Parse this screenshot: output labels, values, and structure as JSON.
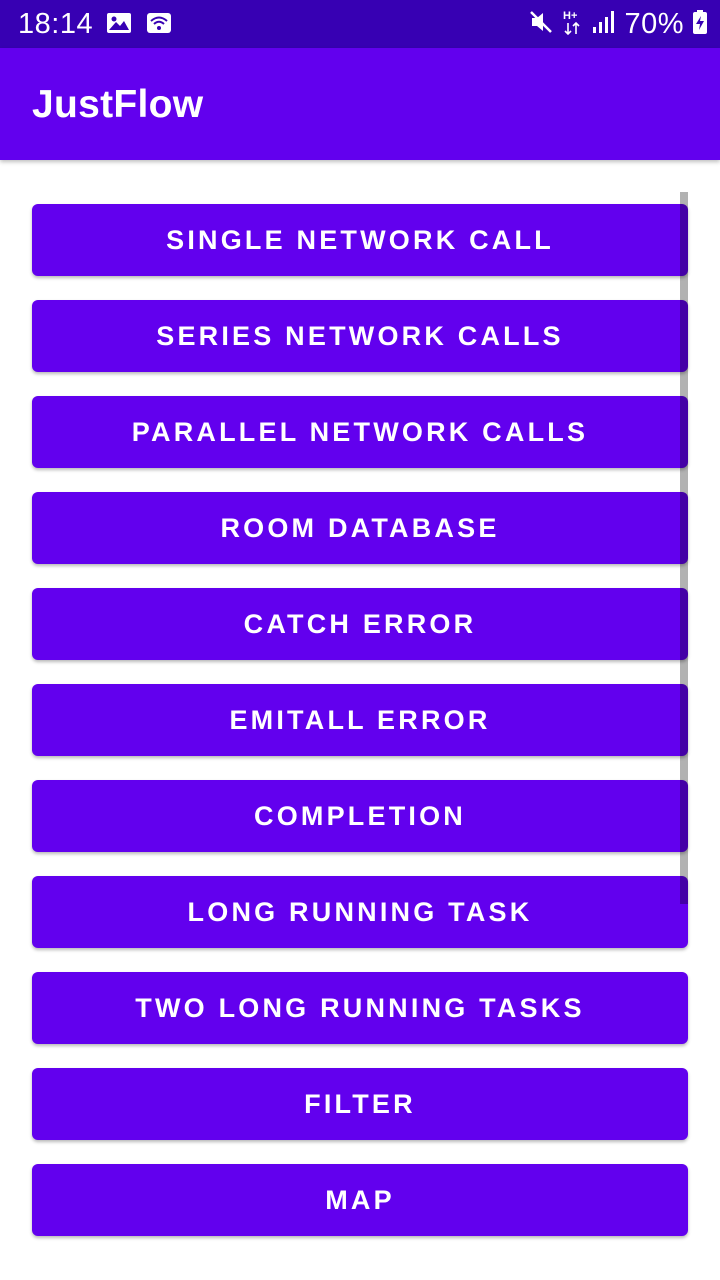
{
  "status_bar": {
    "time": "18:14",
    "battery_percent": "70%",
    "icons": [
      "gallery-icon",
      "wifi-icon",
      "mute-icon",
      "hplus-data-icon",
      "signal-icon",
      "battery-charging-icon"
    ]
  },
  "app_bar": {
    "title": "JustFlow"
  },
  "buttons": [
    {
      "label": "SINGLE NETWORK CALL"
    },
    {
      "label": "SERIES NETWORK CALLS"
    },
    {
      "label": "PARALLEL NETWORK CALLS"
    },
    {
      "label": "ROOM DATABASE"
    },
    {
      "label": "CATCH ERROR"
    },
    {
      "label": "EMITALL ERROR"
    },
    {
      "label": "COMPLETION"
    },
    {
      "label": "LONG RUNNING TASK"
    },
    {
      "label": "TWO LONG RUNNING TASKS"
    },
    {
      "label": "FILTER"
    },
    {
      "label": "MAP"
    }
  ],
  "colors": {
    "status_bar": "#3700b3",
    "primary": "#6200ee",
    "on_primary": "#ffffff",
    "background": "#ffffff"
  }
}
